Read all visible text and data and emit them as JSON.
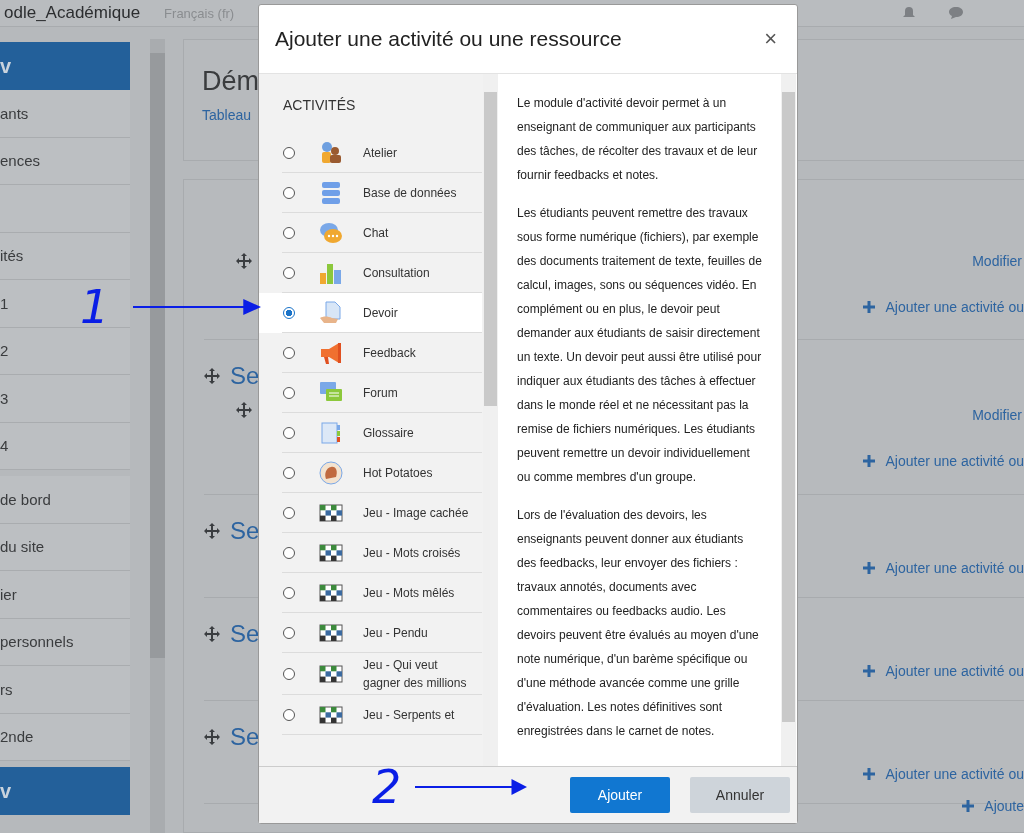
{
  "top_bar": {
    "site_name": "odle_Académique",
    "language": "Français (fr)"
  },
  "sidebar": {
    "groups": [
      {
        "header": "v",
        "items": [
          {
            "label": "ants",
            "kind": "link"
          },
          {
            "label": "ences",
            "kind": "link"
          },
          {
            "kind": "blank"
          },
          {
            "label": "ités",
            "kind": "link"
          },
          {
            "label": "1",
            "kind": "link"
          },
          {
            "label": "2",
            "kind": "link"
          },
          {
            "label": "3",
            "kind": "link"
          },
          {
            "label": "4",
            "kind": "link"
          }
        ]
      },
      {
        "items": [
          {
            "label": "de bord",
            "kind": "link"
          },
          {
            "label": "du site",
            "kind": "link"
          },
          {
            "label": "ier",
            "kind": "link"
          },
          {
            "label": "personnels",
            "kind": "link"
          },
          {
            "label": "rs",
            "kind": "link"
          },
          {
            "label": "2nde",
            "kind": "link"
          }
        ]
      },
      {
        "header": "v"
      }
    ]
  },
  "page_header": {
    "title": "Dém",
    "breadcrumb": "Tableau"
  },
  "sections": [
    {
      "modifier": "Modifier",
      "add": "Ajouter une activité ou",
      "activity": true
    },
    {
      "title": "Se",
      "modifier": "Modifier",
      "add": "Ajouter une activité ou",
      "activity": true
    },
    {
      "title": "Se",
      "add": "Ajouter une activité ou",
      "activity": false
    },
    {
      "title": "Se",
      "add": "Ajouter une activité ou",
      "activity": false
    },
    {
      "title": "Se",
      "add": "Ajouter une activité ou",
      "activity": false,
      "extra_add": "Ajoute"
    }
  ],
  "dialog": {
    "title": "Ajouter une activité ou une ressource",
    "close": "×",
    "list_heading": "ACTIVITÉS",
    "items": [
      {
        "label": "Atelier",
        "kind": "workshop",
        "selected": false
      },
      {
        "label": "Base de données",
        "kind": "database",
        "selected": false
      },
      {
        "label": "Chat",
        "kind": "chat",
        "selected": false
      },
      {
        "label": "Consultation",
        "kind": "poll",
        "selected": false
      },
      {
        "label": "Devoir",
        "kind": "assignment",
        "selected": true
      },
      {
        "label": "Feedback",
        "kind": "feedback",
        "selected": false
      },
      {
        "label": "Forum",
        "kind": "forum",
        "selected": false
      },
      {
        "label": "Glossaire",
        "kind": "glossary",
        "selected": false
      },
      {
        "label": "Hot Potatoes",
        "kind": "hotpot",
        "selected": false
      },
      {
        "label": "Jeu - Image cachée",
        "kind": "game",
        "selected": false
      },
      {
        "label": "Jeu - Mots croisés",
        "kind": "game",
        "selected": false
      },
      {
        "label": "Jeu - Mots mêlés",
        "kind": "game",
        "selected": false
      },
      {
        "label": "Jeu - Pendu",
        "kind": "game",
        "selected": false
      },
      {
        "label": "Jeu - Qui veut gagner des millions",
        "kind": "game",
        "selected": false
      },
      {
        "label": "Jeu - Serpents et",
        "kind": "game",
        "selected": false
      }
    ],
    "description": [
      "Le module d'activité devoir permet à un enseignant de communiquer aux participants des tâches, de récolter des travaux et de leur fournir feedbacks et notes.",
      "Les étudiants peuvent remettre des travaux sous forme numérique (fichiers), par exemple des documents traitement de texte, feuilles de calcul, images, sons ou séquences vidéo. En complément ou en plus, le devoir peut demander aux étudiants de saisir directement un texte. Un devoir peut aussi être utilisé pour indiquer aux étudiants des tâches à effectuer dans le monde réel et ne nécessitant pas la remise de fichiers numériques. Les étudiants peuvent remettre un devoir individuellement ou comme membres d'un groupe.",
      "Lors de l'évaluation des devoirs, les enseignants peuvent donner aux étudiants des feedbacks, leur envoyer des fichiers : travaux annotés, documents avec commentaires ou feedbacks audio. Les devoirs peuvent être évalués au moyen d'une note numérique, d'un barème spécifique ou d'une méthode avancée comme une grille d'évaluation. Les notes définitives sont enregistrées dans le carnet de notes."
    ],
    "buttons": [
      {
        "label": "Ajouter",
        "kind": "primary"
      },
      {
        "label": "Annuler",
        "kind": "secondary"
      }
    ]
  },
  "annotations": [
    {
      "label": "1",
      "kind": "step"
    },
    {
      "label": "2",
      "kind": "step"
    }
  ]
}
